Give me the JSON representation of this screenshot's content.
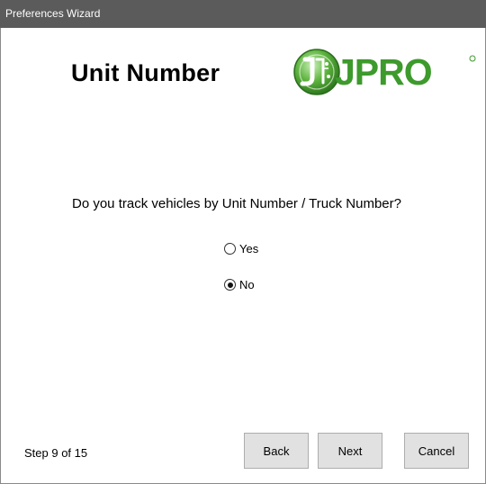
{
  "window": {
    "title": "Preferences Wizard"
  },
  "page": {
    "heading": "Unit Number",
    "logo_text": "JPRO",
    "question": "Do you track vehicles by Unit Number / Truck Number?"
  },
  "options": [
    {
      "label": "Yes",
      "selected": false
    },
    {
      "label": "No",
      "selected": true
    }
  ],
  "footer": {
    "step_text": "Step 9 of 15",
    "back_label": "Back",
    "next_label": "Next",
    "cancel_label": "Cancel"
  },
  "colors": {
    "titlebar": "#5b5b5b",
    "brand_green": "#3d9a2c"
  }
}
